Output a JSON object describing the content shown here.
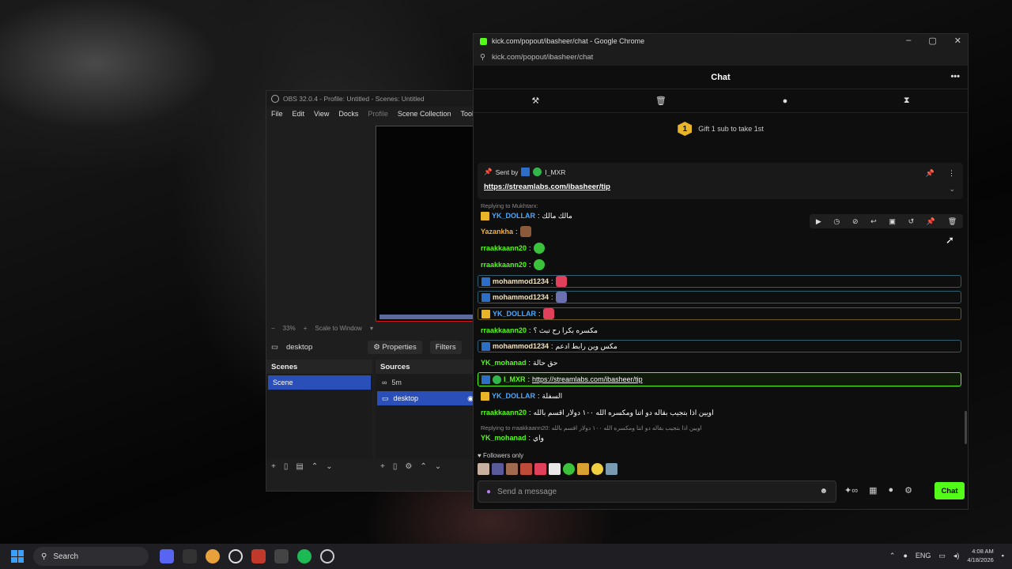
{
  "obs": {
    "title": "OBS 32.0.4 - Profile: Untitled - Scenes: Untitled",
    "menu": [
      "File",
      "Edit",
      "View",
      "Docks",
      "Profile",
      "Scene Collection",
      "Tools"
    ],
    "zoom": "33%",
    "scale_mode": "Scale to Window",
    "source_label": "desktop",
    "properties": "Properties",
    "filters": "Filters",
    "scenes_header": "Scenes",
    "scenes": [
      "Scene"
    ],
    "sources_header": "Sources",
    "sources": [
      "5m",
      "desktop"
    ]
  },
  "chrome": {
    "title": "kick.com/popout/ibasheer/chat - Google Chrome",
    "address": "kick.com/popout/ibasheer/chat"
  },
  "chat": {
    "header": "Chat",
    "gift_badge": "1",
    "gift_text": "Gift 1 sub to take 1st",
    "pinned": {
      "sent_by": "Sent by",
      "user": "I_MXR",
      "link": "https://streamlabs.com/ibasheer/tip"
    },
    "reply1": "Replying to Mukhtarx:",
    "messages": [
      {
        "user": "YK_DOLLAR",
        "text": "مالك مالك"
      },
      {
        "user": "Yazankha",
        "text": ""
      },
      {
        "user": "rraakkaann20",
        "text": ""
      },
      {
        "user": "rraakkaann20",
        "text": ""
      },
      {
        "user": "mohammod1234",
        "text": ""
      },
      {
        "user": "mohammod1234",
        "text": ""
      },
      {
        "user": "YK_DOLLAR",
        "text": ""
      },
      {
        "user": "rraakkaann20",
        "text": "مكسره بكرا رح تبث ؟"
      },
      {
        "user": "mohammod1234",
        "text": "مكس وين رابط ادعم"
      },
      {
        "user": "YK_mohanad",
        "text": "حق حالة"
      },
      {
        "user": "I_MXR",
        "text": "https://streamlabs.com/ibasheer/tip"
      },
      {
        "user": "YK_DOLLAR",
        "text": "السفلة"
      },
      {
        "user": "rraakkaann20",
        "text": "اويين اذا بتجيب بقاله دو اتنا ومكسره الله ١٠٠ دولار اقسم بالله"
      },
      {
        "user": "YK_mohanad",
        "text": "واي"
      }
    ],
    "reply2": "Replying to rraakkaann20: اويين اذا بتجيب بقاله دو اتنا ومكسره الله ١٠٠ دولار اقسم بالله",
    "followers_only": "Followers only",
    "input_placeholder": "Send a message",
    "send_button": "Chat"
  },
  "taskbar": {
    "search": "Search",
    "lang": "ENG",
    "time": "4:08 AM",
    "date": "4/18/2026"
  },
  "colors": {
    "kick_green": "#53fc18",
    "user_green": "#53fc18",
    "user_blue": "#4aa8ff",
    "user_orange": "#f0b040",
    "user_gold": "#f2c94c",
    "obs_selected": "#2b4fb8"
  }
}
